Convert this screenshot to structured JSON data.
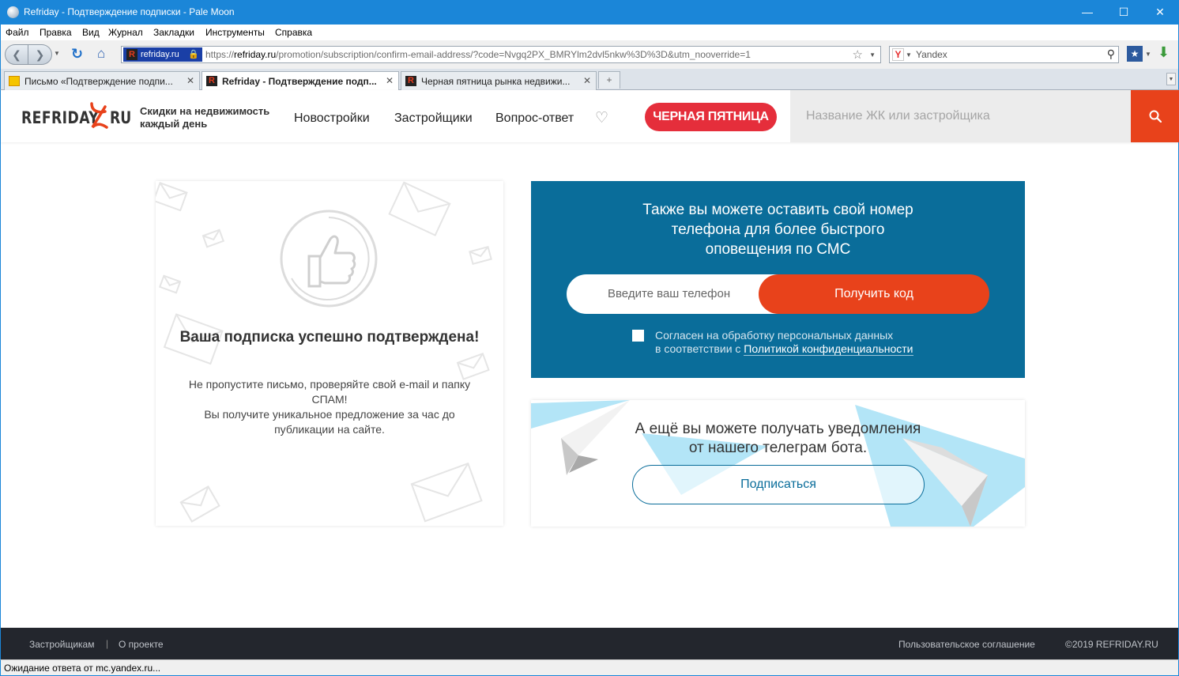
{
  "window": {
    "title": "Refriday - Подтверждение подписки - Pale Moon",
    "minimize": "—",
    "maximize": "☐",
    "close": "✕"
  },
  "menu": [
    "Файл",
    "Правка",
    "Вид",
    "Журнал",
    "Закладки",
    "Инструменты",
    "Справка"
  ],
  "navbar": {
    "identity": "refriday.ru",
    "url_host": "refriday.ru",
    "url_scheme": "https://",
    "url_path": "/promotion/subscription/confirm-email-address/?code=Nvgq2PX_BMRYlm2dvl5nkw%3D%3D&utm_nooverride=1",
    "search_engine": "Yandex"
  },
  "tabs": [
    {
      "label": "Письмо «Подтверждение подпи...",
      "icon": "mail-icon",
      "active": false
    },
    {
      "label": "Refriday - Подтверждение подп...",
      "icon": "refriday-icon",
      "active": true
    },
    {
      "label": "Черная пятница рынка недвижи...",
      "icon": "refriday-icon",
      "active": false
    }
  ],
  "site": {
    "logo_left": "REFRIDAY",
    "logo_right": "RU",
    "tagline": "Скидки на недвижимость каждый день",
    "nav": [
      "Новостройки",
      "Застройщики",
      "Вопрос-ответ"
    ],
    "black_friday": "ЧЕРНАЯ ПЯТНИЦА",
    "search_placeholder": "Название ЖК или застройщика"
  },
  "confirm_card": {
    "title": "Ваша подписка успешно подтверждена!",
    "line1": "Не пропустите письмо, проверяйте свой e-mail и папку СПАМ!",
    "line2": "Вы получите уникальное предложение за час до публикации на сайте."
  },
  "sms_card": {
    "title": "Также вы можете оставить свой номер телефона для более быстрого оповещения по СМС",
    "phone_placeholder": "Введите ваш телефон",
    "button": "Получить код",
    "agree_line1": "Согласен на обработку персональных данных",
    "agree_line2_prefix": "в соответствии с ",
    "agree_link": "Политикой конфиденциальности"
  },
  "telegram_card": {
    "title": "А ещё вы можете получать уведомления от нашего телеграм бота.",
    "button": "Подписаться"
  },
  "footer": {
    "developers": "Застройщикам",
    "separator": "|",
    "about": "О проекте",
    "agreement": "Пользовательское соглашение",
    "copyright": "©2019 REFRIDAY.RU"
  },
  "status": "Ожидание ответа от mc.yandex.ru...",
  "colors": {
    "accent_orange": "#e8421b",
    "black_friday_red": "#e52e3b",
    "sms_blue": "#0a6d9a",
    "telegram_light_blue": "#b3e5f7",
    "footer_dark": "#23262d"
  }
}
